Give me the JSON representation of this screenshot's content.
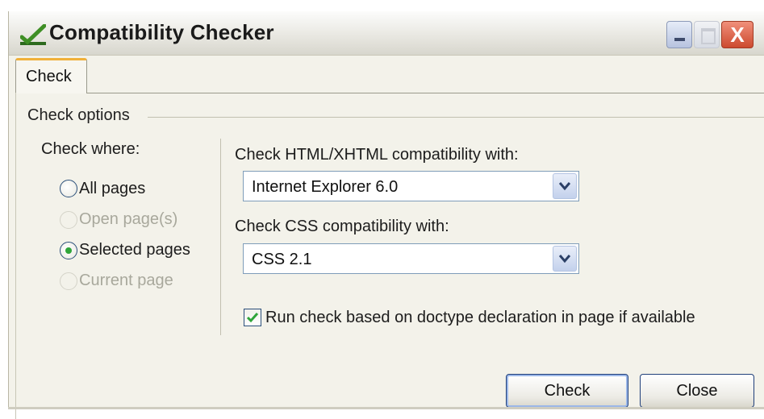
{
  "window": {
    "title": "Compatibility Checker",
    "icon": "checkmark-icon",
    "controls": [
      "minimize-icon",
      "maximize-icon",
      "close-icon"
    ],
    "close_glyph": "X"
  },
  "tabs": [
    {
      "label": "Check",
      "active": true
    }
  ],
  "check_options": {
    "group_title": "Check options",
    "check_where": {
      "label": "Check where:",
      "options": [
        {
          "label": "All pages",
          "enabled": true,
          "selected": false
        },
        {
          "label": "Open page(s)",
          "enabled": false,
          "selected": false
        },
        {
          "label": "Selected pages",
          "enabled": true,
          "selected": true
        },
        {
          "label": "Current page",
          "enabled": false,
          "selected": false
        }
      ]
    },
    "html": {
      "label": "Check HTML/XHTML compatibility with:",
      "value": "Internet Explorer 6.0"
    },
    "css": {
      "label": "Check CSS compatibility with:",
      "value": "CSS 2.1"
    },
    "doctype": {
      "label": "Run check based on doctype declaration in page if available",
      "checked": true
    }
  },
  "buttons": {
    "check": "Check",
    "close": "Close"
  },
  "colors": {
    "accent_tab": "#f0b03a",
    "radio_dot": "#2fa53a",
    "close_button": "#cc4a2f"
  }
}
